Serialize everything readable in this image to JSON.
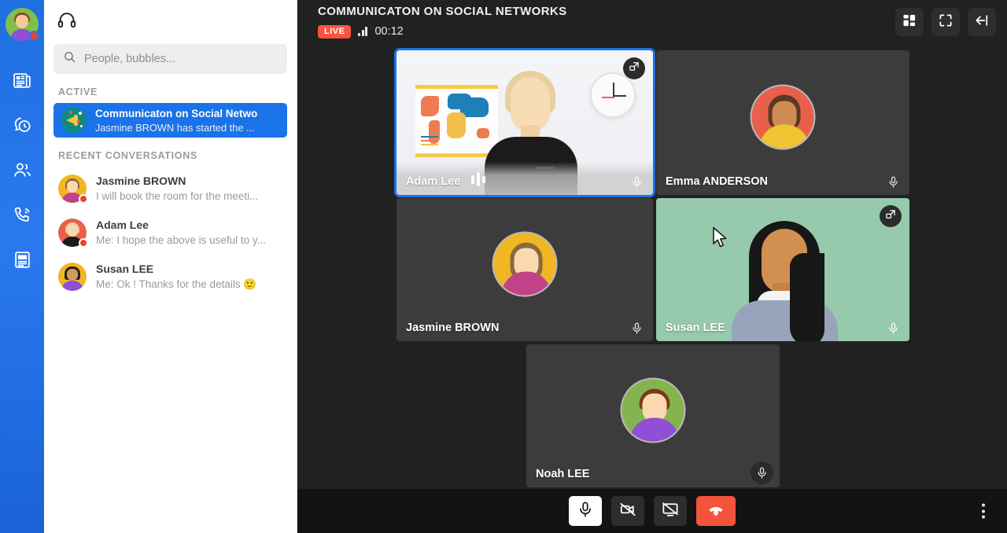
{
  "rail": {
    "avatar_name": "user-avatar",
    "status_color": "#f2402c",
    "items": [
      {
        "name": "news-icon",
        "label": "News"
      },
      {
        "name": "bubbles-icon",
        "label": "Bubbles"
      },
      {
        "name": "contacts-icon",
        "label": "Contacts"
      },
      {
        "name": "calls-icon",
        "label": "Calls"
      },
      {
        "name": "documents-icon",
        "label": "Documents"
      }
    ]
  },
  "panel": {
    "headset_icon": "headset-icon",
    "search": {
      "placeholder": "People, bubbles...",
      "value": "",
      "icon": "search-icon"
    },
    "active_label": "ACTIVE",
    "active_conversation": {
      "title": "Communicaton on Social Netwo",
      "subtitle": "Jasmine BROWN has started the ...",
      "icon": "megaphone-icon"
    },
    "recent_label": "RECENT CONVERSATIONS",
    "recent": [
      {
        "name": "Jasmine BROWN",
        "message": "I will book the room for the meeti...",
        "hair": "#8a6a3d",
        "body": "#c2428a",
        "ring": "#f0b722"
      },
      {
        "name": "Adam Lee",
        "message": "Me: I hope the above is useful to y...",
        "hair": "#e8cf9e",
        "body": "#1b1b1b",
        "ring": "#e8604c"
      },
      {
        "name": "Susan LEE",
        "message": "Me: Ok ! Thanks for the details  🙂",
        "hair": "#2b2118",
        "body": "#8f4fd6",
        "ring": "#f0b722"
      }
    ]
  },
  "meeting": {
    "title": "COMMUNICATON ON SOCIAL NETWORKS",
    "live_label": "LIVE",
    "live_color": "#fb5342",
    "timer": "00:12",
    "signal_icon": "signal-bars-icon",
    "header_buttons": [
      {
        "name": "grid-layout-button",
        "icon": "grid-layout-icon"
      },
      {
        "name": "fullscreen-button",
        "icon": "fullscreen-icon"
      },
      {
        "name": "collapse-panel-button",
        "icon": "arrow-left-bar-icon"
      }
    ],
    "participants": [
      {
        "name": "Adam Lee",
        "video": true,
        "selected": true,
        "speaking": true,
        "pop_out": true,
        "mic_badged": false,
        "bg": "#eceef2"
      },
      {
        "name": "Emma ANDERSON",
        "video": false,
        "selected": false,
        "speaking": false,
        "pop_out": false,
        "mic_badged": false,
        "bg": "#3c3c3c",
        "avatar_ring": "#e8604c",
        "hair": "#5a3a22",
        "body": "#f0c330"
      },
      {
        "name": "Jasmine BROWN",
        "video": false,
        "selected": false,
        "speaking": false,
        "pop_out": false,
        "mic_badged": false,
        "bg": "#3c3c3c",
        "avatar_ring": "#f0b722",
        "hair": "#8a6a3d",
        "body": "#c2428a"
      },
      {
        "name": "Susan LEE",
        "video": true,
        "selected": false,
        "speaking": false,
        "pop_out": true,
        "mic_badged": false,
        "bg": "#97c9ac"
      },
      {
        "name": "Noah LEE",
        "video": false,
        "selected": false,
        "speaking": false,
        "pop_out": false,
        "mic_badged": true,
        "bg": "#3c3c3c",
        "avatar_ring": "#85b44f",
        "hair": "#7a3c18",
        "body": "#8f4fd6"
      }
    ],
    "controls": [
      {
        "name": "microphone-button",
        "icon": "microphone-icon",
        "state": "on"
      },
      {
        "name": "camera-button",
        "icon": "camera-off-icon",
        "state": "off"
      },
      {
        "name": "screenshare-button",
        "icon": "screen-share-off-icon",
        "state": "off"
      },
      {
        "name": "hangup-button",
        "icon": "hangup-icon",
        "state": "danger"
      }
    ],
    "more_menu_icon": "more-vertical-icon"
  }
}
